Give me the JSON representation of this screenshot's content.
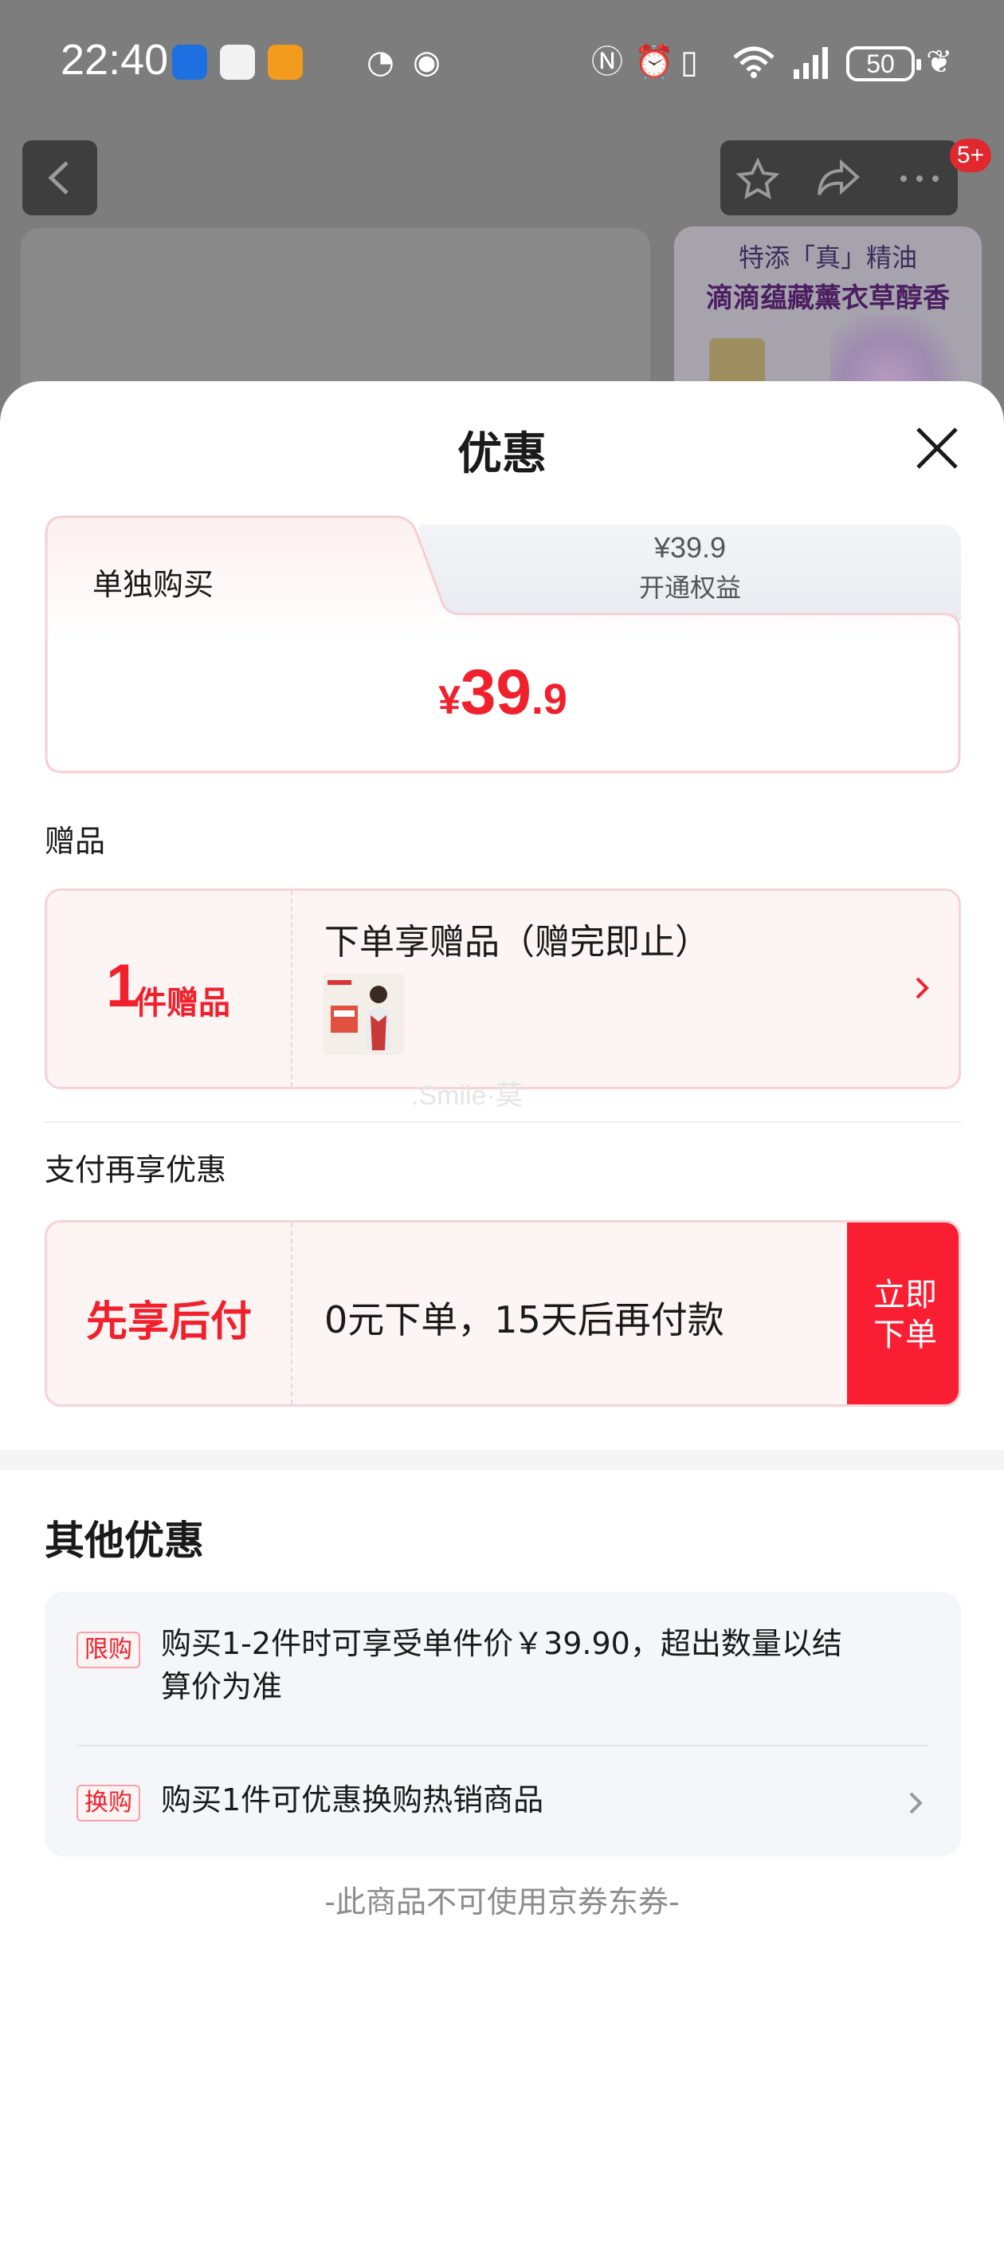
{
  "status_bar": {
    "time": "22:40",
    "battery": "50",
    "icons": [
      "nfc-icon",
      "alarm-icon",
      "vibrate-icon",
      "wifi-icon",
      "signal-icon",
      "battery-icon",
      "leaf-icon"
    ]
  },
  "background_page": {
    "badge": "5+",
    "promo_line1": "特添「真」精油",
    "promo_line2": "滴滴蕴藏薰衣草醇香"
  },
  "sheet": {
    "title": "优惠",
    "tabs": {
      "solo_label": "单独购买",
      "member_price": "¥39.9",
      "member_label": "开通权益"
    },
    "price": {
      "currency": "¥",
      "integer": "39",
      "decimal": ".9"
    },
    "gift_section_label": "赠品",
    "gift": {
      "count": "1",
      "count_label": "件赠品",
      "title": "下单享赠品（赠完即止）"
    },
    "watermark": ".Smile·莫",
    "pay_section_label": "支付再享优惠",
    "pay": {
      "label": "先享后付",
      "desc": "0元下单，15天后再付款",
      "button_line1": "立即",
      "button_line2": "下单"
    },
    "other_title": "其他优惠",
    "other_items": [
      {
        "tag": "限购",
        "text_line1": "购买1-2件时可享受单件价￥39.90，超出数量以结",
        "text_line2": "算价为准"
      },
      {
        "tag": "换购",
        "text_line1": "购买1件可优惠换购热销商品"
      }
    ],
    "footer_note": "-此商品不可使用京券东券-"
  }
}
